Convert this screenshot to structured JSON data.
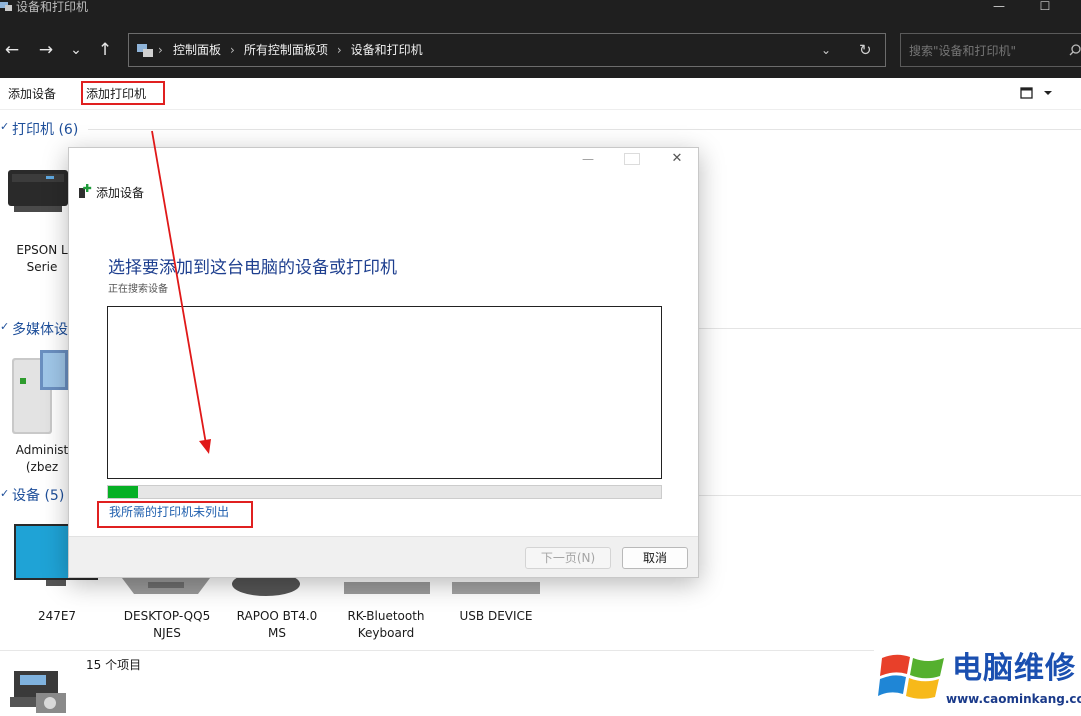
{
  "window": {
    "title": "设备和打印机",
    "minimize": "—",
    "maximize": "☐"
  },
  "nav": {
    "back": "←",
    "forward": "→",
    "recent": "⌄",
    "up": "↑"
  },
  "address": {
    "crumbs": [
      "控制面板",
      "所有控制面板项",
      "设备和打印机"
    ],
    "dropdown": "⌄",
    "refresh": "↻"
  },
  "search": {
    "placeholder": "搜索\"设备和打印机\""
  },
  "commands": {
    "add_device": "添加设备",
    "add_printer": "添加打印机"
  },
  "groups": {
    "printers": {
      "title": "打印机 (6)"
    },
    "multimedia": {
      "title": "多媒体设"
    },
    "devices": {
      "title": "设备 (5)"
    }
  },
  "printer_items": [
    {
      "line1": "EPSON L",
      "line2": "Serie"
    }
  ],
  "multimedia_items": [
    {
      "line1": "Administ",
      "line2": "(zbez"
    }
  ],
  "device_items": [
    {
      "line1": "247E7",
      "line2": ""
    },
    {
      "line1": "DESKTOP-QQ5",
      "line2": "NJES"
    },
    {
      "line1": "RAPOO BT4.0",
      "line2": "MS"
    },
    {
      "line1": "RK-Bluetooth",
      "line2": "Keyboard"
    },
    {
      "line1": "USB DEVICE",
      "line2": ""
    }
  ],
  "dialog": {
    "window_title": "添加设备",
    "heading": "选择要添加到这台电脑的设备或打印机",
    "status": "正在搜索设备",
    "progress_fraction": 0.055,
    "not_listed_link": "我所需的打印机未列出",
    "next_button": "下一页(N)",
    "cancel_button": "取消",
    "close": "✕"
  },
  "statusbar": {
    "count_text": "15 个项目"
  },
  "watermark": {
    "brand": "电脑维修",
    "url": "www.caominkang.com"
  },
  "colors": {
    "accent_blue": "#1e4f9a",
    "highlight_red": "#e02020",
    "progress_green": "#06b025",
    "dark_chrome": "#1f1f1f"
  }
}
